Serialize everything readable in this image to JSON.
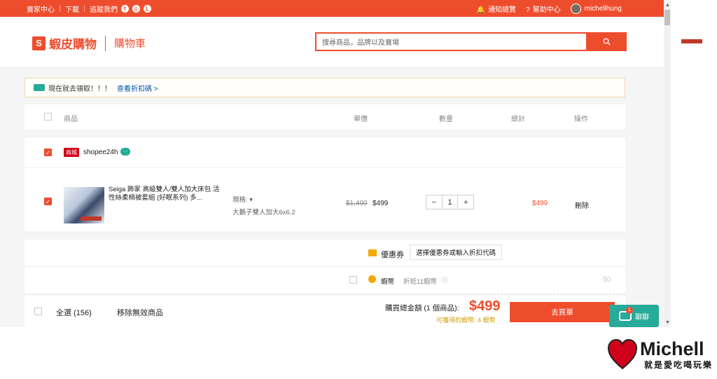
{
  "topbar": {
    "seller_center": "賣家中心",
    "download": "下載",
    "follow_us": "追蹤我們",
    "social_icons": [
      "facebook-icon",
      "instagram-icon",
      "line-icon"
    ],
    "notifications": "通知總覽",
    "help": "幫助中心",
    "username": "michellhung"
  },
  "header": {
    "brand": "蝦皮購物",
    "page_title": "購物車",
    "search_placeholder": "搜尋商品，品牌以及賣場"
  },
  "promo": {
    "text": "現在就去領取！！！",
    "link": "查看折扣碼 >"
  },
  "columns": {
    "product": "商品",
    "unit_price": "單價",
    "quantity": "數量",
    "total": "總計",
    "action": "操作"
  },
  "shop": {
    "badge": "商城",
    "name": "shopee24h"
  },
  "item": {
    "name": "Seiga 飾家 高級雙人/雙人加大床包 活性絲柔棉被套組 (好眠系列) 多...",
    "variation_label": "規格:",
    "variation_value": "大鵝子雙人加大6x6.2",
    "price_original": "$1,490",
    "price": "$499",
    "quantity": "1",
    "total": "$499",
    "delete": "刪除"
  },
  "voucher": {
    "label": "優惠券",
    "button": "選擇優惠券或輸入折扣代碼"
  },
  "coins": {
    "label": "蝦幣",
    "note": "折抵11蝦幣",
    "amount": "-$0"
  },
  "checkout": {
    "select_all": "全選 (156)",
    "remove_invalid": "移除無效商品",
    "summary_label": "購買總金額 (1 個商品):",
    "summary_amount": "$499",
    "coins_earned": "可獲得的蝦幣: 4 蝦幣",
    "buy_button": "去買單"
  },
  "chat": {
    "label": "聊聊",
    "badge": "1"
  },
  "watermark": {
    "name": "Michell",
    "tagline": "就是愛吃喝玩樂"
  },
  "colors": {
    "brand": "#ee4d2d",
    "chat": "#26aa99"
  }
}
